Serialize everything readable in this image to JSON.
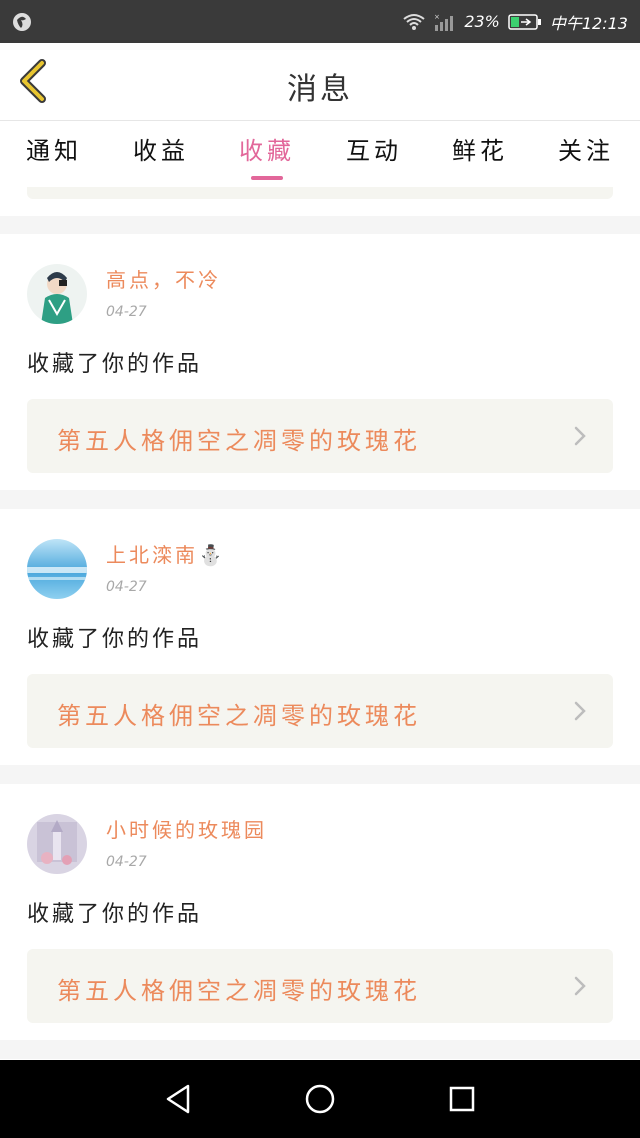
{
  "status_bar": {
    "battery_percent": "23%",
    "time": "中午12:13",
    "icons": [
      "app-icon",
      "wifi-icon",
      "signal-icon",
      "battery-icon"
    ]
  },
  "header": {
    "title": "消息",
    "back_icon": "chevron-left-icon"
  },
  "tabs": [
    {
      "label": "通知",
      "active": false
    },
    {
      "label": "收益",
      "active": false
    },
    {
      "label": "收藏",
      "active": true
    },
    {
      "label": "互动",
      "active": false
    },
    {
      "label": "鲜花",
      "active": false
    },
    {
      "label": "关注",
      "active": false
    }
  ],
  "notifications": [
    {
      "username": "高点，不冷",
      "date": "04-27",
      "action": "收藏了你的作品",
      "work_title": "第五人格佣空之凋零的玫瑰花"
    },
    {
      "username": "上北滦南⛄",
      "date": "04-27",
      "action": "收藏了你的作品",
      "work_title": "第五人格佣空之凋零的玫瑰花"
    },
    {
      "username": "小时候的玫瑰园",
      "date": "04-27",
      "action": "收藏了你的作品",
      "work_title": "第五人格佣空之凋零的玫瑰花"
    }
  ],
  "colors": {
    "accent_pink": "#e2679a",
    "accent_orange": "#ec8a5c",
    "back_icon_yellow": "#e8c530"
  }
}
